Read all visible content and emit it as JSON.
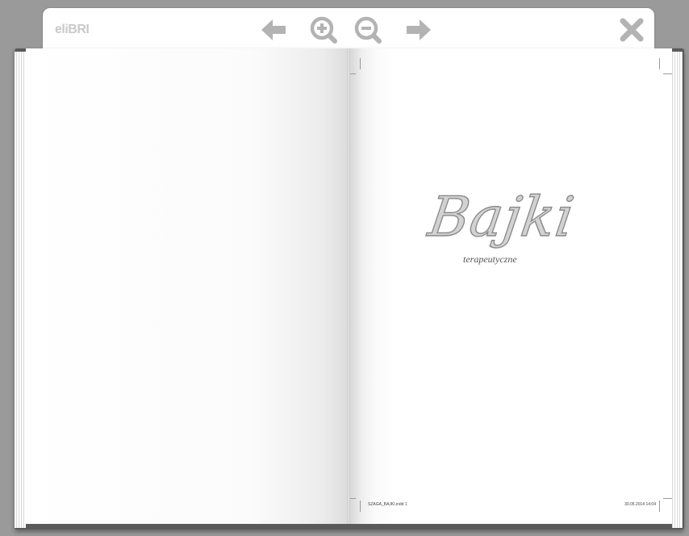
{
  "toolbar": {
    "logo": "eliBRI",
    "prev_icon": "arrow-left-icon",
    "zoom_in_icon": "zoom-in-icon",
    "zoom_out_icon": "zoom-out-icon",
    "next_icon": "arrow-right-icon",
    "close_icon": "close-icon",
    "icon_color": "#b3b3b3"
  },
  "right_page": {
    "title": "Bajki",
    "subtitle": "terapeutyczne",
    "slug_file": "SZAGA_BAJKI.indd   1",
    "slug_date": "30.05.2014   14:04"
  },
  "colors": {
    "background": "#9a9a9a",
    "toolbar": "#ffffff",
    "page": "#ffffff"
  }
}
